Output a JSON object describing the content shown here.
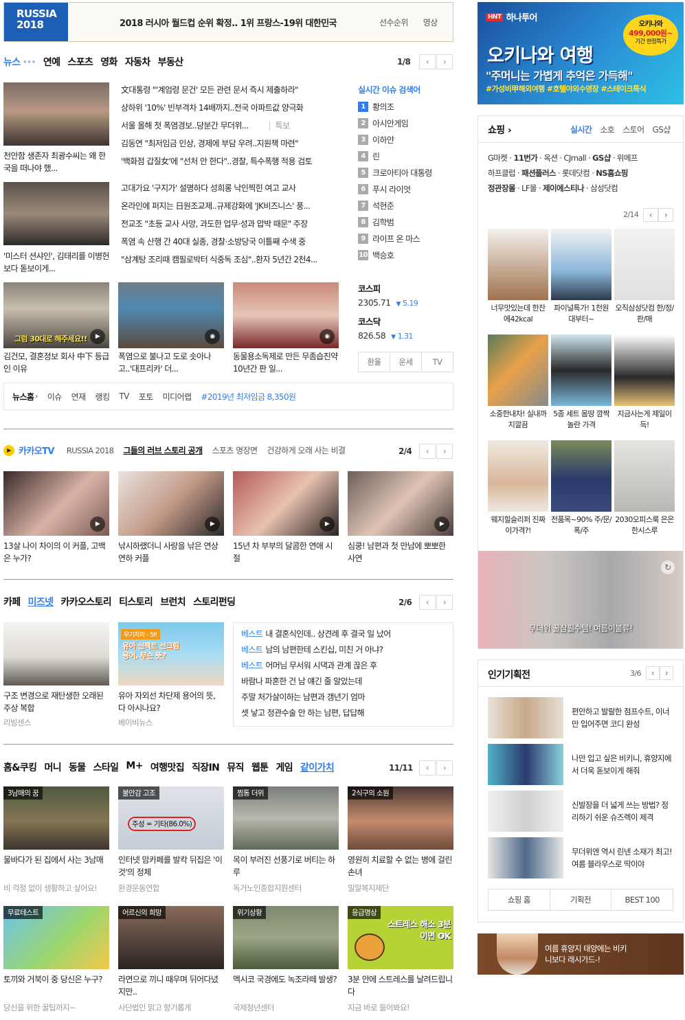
{
  "topbar": {
    "logo_line1": "RUSSIA",
    "logo_line2": "2018",
    "headline": "2018 러시아 월드컵 순위 확정.. 1위 프랑스-19위 대한민국",
    "links": [
      "선수순위",
      "영상"
    ]
  },
  "news": {
    "tabs": [
      "뉴스",
      "연예",
      "스포츠",
      "영화",
      "자동차",
      "부동산"
    ],
    "page": "1/8",
    "photos": [
      {
        "caption": "천안함 생존자 최광수씨는 왜 한국을 떠나야 했..."
      },
      {
        "caption": "'미스터 션샤인', 김태리를 이병헌보다 돋보이게..."
      },
      {
        "caption": "김건모, 결혼정보 회사 中下 등급인 이유",
        "overlay": "그럼 30대로 해주세요!!"
      },
      {
        "caption": "폭염으로 불나고 도로 솟아나고..'대프리카' 더..."
      },
      {
        "caption": "동물용소독제로 만든 무좀습진약 10년간 판 일..."
      }
    ],
    "headlines": [
      "文대통령 \"'계엄령 문건' 모든 관련 문서 즉시 제출하라\"",
      "상하위 '10%' 빈부격차 14배까지..전국 아파트값 양극화",
      "서울 올해 첫 폭염경보..당분간 무더위...",
      "김동연 \"최저임금 인상, 경제에 부담 우려..지원책 마련\"",
      "'백화점 갑질女'에 \"선처 안 한다\"..경찰, 특수폭행 적용 검토",
      "고대가요 '구지가' 설명하다 성희롱 낙인찍힌 여고 교사",
      "온라인에 퍼지는 日원조교제..규제강화에 'JK비즈니스' 풍...",
      "전교조 \"초등 교사 사망, 과도한 업무·성과 압박 때문\" 주장",
      "폭염 속 산행 간 40대 실종, 경찰·소방당국 이틀째 수색 중",
      "\"삼계탕 조리때 캠필로박터 식중독 조심\"..환자 5년간 2천4..."
    ],
    "special": "특보",
    "realtime": {
      "title": "실시간 이슈 검색어",
      "items": [
        "황의조",
        "아시안게임",
        "이하얀",
        "린",
        "크로아티아 대통령",
        "푸시 라이엇",
        "석현준",
        "김학범",
        "라이프 온 마스",
        "백승호"
      ]
    },
    "stocks": [
      {
        "name": "코스피",
        "value": "2305.71",
        "change": "5.19"
      },
      {
        "name": "코스닥",
        "value": "826.58",
        "change": "1.31"
      }
    ],
    "fin_tabs": [
      "환율",
      "운세",
      "TV"
    ],
    "footer": {
      "home": "뉴스홈",
      "links": [
        "이슈",
        "연재",
        "랭킹",
        "TV",
        "포토",
        "미디어랩"
      ],
      "highlight": "#2019년 최저임금 8,350원"
    }
  },
  "kakaotv": {
    "title": "카카오TV",
    "tabs": [
      "RUSSIA 2018",
      "그들의 러브 스토리 공개",
      "스포츠 명장면",
      "건강하게 오래 사는 비결"
    ],
    "page": "2/4",
    "items": [
      "13살 나이 차이의 이 커플, 고백은 누가?",
      "낚시하랬더니 사랑을 낚은 연상연하 커플",
      "15년 차 부부의 달콤한 연애 시절",
      "심쿵! 남편과 첫 만남에 뽀뽀한 사연"
    ]
  },
  "cafe": {
    "tabs": [
      "카페",
      "미즈넷",
      "카카오스토리",
      "티스토리",
      "브런치",
      "스토리펀딩"
    ],
    "page": "2/6",
    "items": [
      {
        "caption": "구조 변경으로 재탄생한 오래된 주상 복합",
        "source": "리빙센스"
      },
      {
        "caption": "유아 자외선 차단제 용어의 뜻, 다 아시나요?",
        "source": "베이비뉴스",
        "overlay_tag": "우기자와 - 5P.",
        "overlay": "유아 선팩트 선크림 용어, 무슨 뜻?"
      }
    ],
    "best_label": "베스트",
    "list": [
      "내 결혼식인데.. 상견례 후 결국 일 났어",
      "남의 남편한테 스킨십, 미친 거 아냐?",
      "어머님 무서워 시댁과 관계 끊은 후",
      "바람나 파혼한 건 남 얘긴 줄 알았는데",
      "주말 처가살이하는 남편과 갱년기 엄마",
      "셋 낳고 정관수술 안 하는 남편, 답답해"
    ]
  },
  "life": {
    "tabs": [
      "홈&쿠킹",
      "머니",
      "동물",
      "스타일",
      "M+",
      "여행맛집",
      "직장IN",
      "뮤직",
      "웹툰",
      "게임",
      "같이가치"
    ],
    "page": "11/11",
    "items": [
      {
        "tag": "3남매의 꿈",
        "caption": "물바다가 된 집에서 사는 3남매",
        "source": "비 걱정 없이 생활하고 싶어요!"
      },
      {
        "tag": "불안감 고조",
        "caption": "인터넷 맘카페를 발칵 뒤집은 '이것'의 정체",
        "source": "환경운동연합",
        "overlay": "주성 = 기타(86.0%)"
      },
      {
        "tag": "찜통 더위",
        "caption": "목이 부러진 선풍기로 버티는 하루",
        "source": "독거노인종합지원센터"
      },
      {
        "tag": "2식구의 소원",
        "caption": "영원히 치료할 수 없는 병에 걸린 손녀",
        "source": "밀알복지재단"
      },
      {
        "tag": "무료테스트",
        "caption": "토끼와 거북이 중 당신은 누구?",
        "source": "당신을 위한 꿀팁까지~"
      },
      {
        "tag": "어르신의 희망",
        "caption": "라면으로 끼니 때우며 뒤어다녔지만..",
        "source": "사단법인 맑고 향기롭게"
      },
      {
        "tag": "위기상황",
        "caption": "멕시코 국경에도 녹조라떼 발생?",
        "source": "국제청년센터"
      },
      {
        "tag": "응급명상",
        "caption": "3분 안에 스트레스를 날려드립니다",
        "source": "지금 바로 들어봐요!",
        "overlay": "스트레스 해소 3분이면 OK"
      }
    ]
  },
  "ad_top": {
    "brand": "하나투어",
    "badge_line1": "오키나와",
    "badge_line2": "499,000원~",
    "badge_line3": "기간 한정특가",
    "title": "오키나와 여행",
    "subtitle": "\"주머니는 가볍게 추억은 가득해\"",
    "tags": "#가성비甲해외여행 #호텔야외수영장 #스테이크특식"
  },
  "shopping": {
    "title": "쇼핑",
    "tabs": [
      "실시간",
      "소호",
      "스토어",
      "GS샵"
    ],
    "malls": [
      "G마켓",
      "11번가",
      "옥션",
      "CJmall",
      "GS샵",
      "위메프",
      "하프클럽",
      "패션플러스",
      "롯데닷컴",
      "NS홈쇼핑",
      "정관장몰",
      "LF몰",
      "제이에스티나",
      "삼성닷컴"
    ],
    "page": "2/14",
    "products": [
      "너무맛있는데 한잔에42kcal",
      "파이널특가! 1천원대부터~",
      "오직삼성닷컴 한/정/판/매",
      "소중한내차! 실내까지깔끔",
      "5종 세트 몸땅 깜짝놀란 가격",
      "지금사는게 제일이득!",
      "웨지힐슬리퍼 진짜 이가격?!",
      "전품목~90% 주/문/폭/주",
      "2030오피스룩 은은한시스루"
    ],
    "banner": "무더위 꿀잠필수템! 여름이불류!"
  },
  "popular": {
    "title": "인기기획전",
    "page": "3/6",
    "items": [
      "편안하고 발랄한 점프수트, 이너만 입어주면 코디 완성",
      "나만 입고 싶은 비키니, 휴양지에서 더욱 돋보이게 해줘",
      "신발장을 더 넓게 쓰는 방법? 정리하기 쉬운 슈즈렉이 제격",
      "무더위엔 역시 린넨 소재가 최고! 여름 블라우스로 딱이야"
    ],
    "links": [
      "쇼핑 홈",
      "기획전",
      "BEST 100"
    ]
  },
  "ad_bottom": {
    "text": "여름 휴양지 태양에는 비키니보다 래시가드-!"
  }
}
